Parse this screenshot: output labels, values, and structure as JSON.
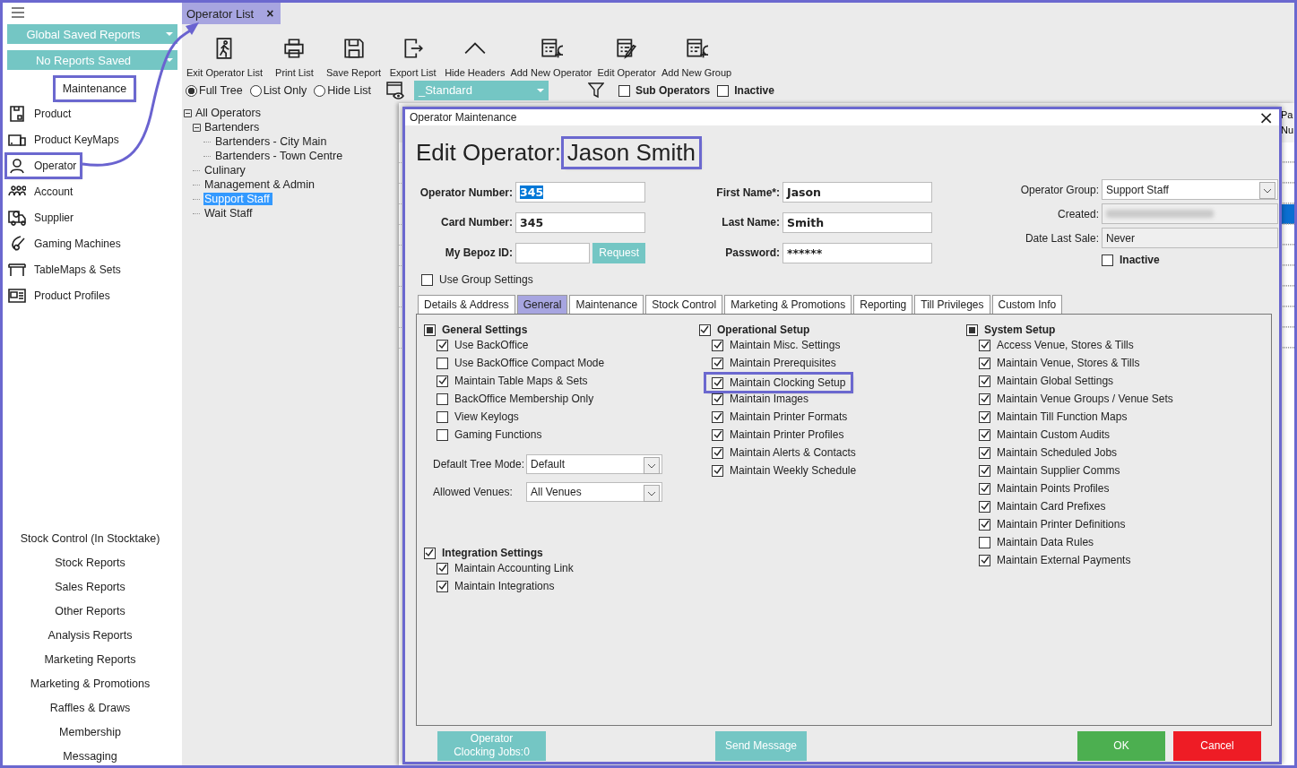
{
  "sidebar": {
    "report_dropdowns": [
      "Global Saved Reports",
      "No Reports Saved"
    ],
    "section": {
      "label": "Maintenance",
      "highlighted": true
    },
    "items": [
      {
        "label": "Product",
        "highlighted": false
      },
      {
        "label": "Product KeyMaps",
        "highlighted": false
      },
      {
        "label": "Operator",
        "highlighted": true
      },
      {
        "label": "Account",
        "highlighted": false
      },
      {
        "label": "Supplier",
        "highlighted": false
      },
      {
        "label": "Gaming Machines",
        "highlighted": false
      },
      {
        "label": "TableMaps & Sets",
        "highlighted": false
      },
      {
        "label": "Product Profiles",
        "highlighted": false
      }
    ],
    "links": [
      "Stock Control (In Stocktake)",
      "Stock Reports",
      "Sales Reports",
      "Other Reports",
      "Analysis Reports",
      "Marketing Reports",
      "Marketing & Promotions",
      "Raffles & Draws",
      "Membership",
      "Messaging"
    ]
  },
  "tab": {
    "label": "Operator List",
    "close": "×"
  },
  "toolbar": [
    "Exit Operator List",
    "Print List",
    "Save Report",
    "Export List",
    "Hide Headers",
    "Add New Operator",
    "Edit Operator",
    "Add New Group"
  ],
  "view_modes": [
    {
      "label": "Full Tree",
      "selected": true
    },
    {
      "label": "List Only",
      "selected": false
    },
    {
      "label": "Hide List",
      "selected": false
    }
  ],
  "layout_dropdown": "_Standard",
  "filters": [
    {
      "label": "Sub Operators",
      "checked": false
    },
    {
      "label": "Inactive",
      "checked": false
    }
  ],
  "tree": [
    {
      "label": "All Operators",
      "expanded": true,
      "selected": false,
      "children": [
        {
          "label": "Bartenders",
          "expanded": true,
          "selected": false,
          "children": [
            {
              "label": "Bartenders - City Main",
              "selected": false
            },
            {
              "label": "Bartenders - Town Centre",
              "selected": false
            }
          ]
        },
        {
          "label": "Culinary",
          "selected": false
        },
        {
          "label": "Management & Admin",
          "selected": false
        },
        {
          "label": "Support Staff",
          "selected": true
        },
        {
          "label": "Wait Staff",
          "selected": false
        }
      ]
    }
  ],
  "grid": {
    "header": [
      "Pa",
      "Nu"
    ],
    "rows": [
      {
        "selected": false
      },
      {
        "selected": false
      },
      {
        "selected": false
      },
      {
        "selected": true
      },
      {
        "selected": false
      },
      {
        "selected": false
      },
      {
        "selected": false
      },
      {
        "selected": false
      },
      {
        "selected": false
      },
      {
        "selected": false
      }
    ]
  },
  "dialog": {
    "title": "Operator Maintenance",
    "close": "×",
    "heading": "Edit Operator:",
    "name": "Jason Smith",
    "name_highlighted": true,
    "operator_number": {
      "label": "Operator Number:",
      "value": "345"
    },
    "card_number": {
      "label": "Card Number:",
      "value": "345"
    },
    "bepoz_id": {
      "label": "My Bepoz ID:",
      "button": "Request"
    },
    "first_name": {
      "label": "First Name*:",
      "value": "Jason"
    },
    "last_name": {
      "label": "Last Name:",
      "value": "Smith"
    },
    "password": {
      "label": "Password:",
      "value": "******"
    },
    "operator_group": {
      "label": "Operator Group:",
      "value": "Support Staff"
    },
    "created": {
      "label": "Created:",
      "redacted": true
    },
    "date_last_sale": {
      "label": "Date Last Sale:",
      "value": "Never"
    },
    "inactive": {
      "label": "Inactive",
      "checked": false
    },
    "use_group_settings": {
      "label": "Use Group Settings",
      "checked": false
    },
    "tabs": [
      {
        "label": "Details & Address",
        "selected": false
      },
      {
        "label": "General",
        "selected": true
      },
      {
        "label": "Maintenance",
        "selected": false
      },
      {
        "label": "Stock Control",
        "selected": false
      },
      {
        "label": "Marketing & Promotions",
        "selected": false
      },
      {
        "label": "Reporting",
        "selected": false
      },
      {
        "label": "Till Privileges",
        "selected": false
      },
      {
        "label": "Custom Info",
        "selected": false
      }
    ],
    "general_settings": {
      "label": "General Settings",
      "checked": false,
      "indeterminate": true,
      "items": [
        {
          "label": "Use BackOffice",
          "checked": true,
          "highlighted": false
        },
        {
          "label": "Use BackOffice Compact Mode",
          "checked": false,
          "highlighted": false
        },
        {
          "label": "Maintain Table Maps & Sets",
          "checked": true,
          "highlighted": false
        },
        {
          "label": "BackOffice Membership Only",
          "checked": false,
          "highlighted": false
        },
        {
          "label": "View Keylogs",
          "checked": false,
          "highlighted": false
        },
        {
          "label": "Gaming Functions",
          "checked": false,
          "highlighted": false
        }
      ]
    },
    "default_tree_mode": {
      "label": "Default Tree Mode:",
      "value": "Default"
    },
    "allowed_venues": {
      "label": "Allowed Venues:",
      "value": "All Venues"
    },
    "integration_settings": {
      "label": "Integration Settings",
      "checked": true,
      "indeterminate": false,
      "items": [
        {
          "label": "Maintain Accounting Link",
          "checked": true,
          "highlighted": false
        },
        {
          "label": "Maintain Integrations",
          "checked": true,
          "highlighted": false
        }
      ]
    },
    "operational_setup": {
      "label": "Operational Setup",
      "checked": true,
      "indeterminate": false,
      "items": [
        {
          "label": "Maintain Misc. Settings",
          "checked": true,
          "highlighted": false
        },
        {
          "label": "Maintain Prerequisites",
          "checked": true,
          "highlighted": false
        },
        {
          "label": "Maintain Clocking Setup",
          "checked": true,
          "highlighted": true
        },
        {
          "label": "Maintain Images",
          "checked": true,
          "highlighted": false
        },
        {
          "label": "Maintain Printer Formats",
          "checked": true,
          "highlighted": false
        },
        {
          "label": "Maintain Printer Profiles",
          "checked": true,
          "highlighted": false
        },
        {
          "label": "Maintain Alerts & Contacts",
          "checked": true,
          "highlighted": false
        },
        {
          "label": "Maintain Weekly Schedule",
          "checked": true,
          "highlighted": false
        }
      ]
    },
    "system_setup": {
      "label": "System Setup",
      "checked": false,
      "indeterminate": true,
      "items": [
        {
          "label": "Access Venue, Stores & Tills",
          "checked": true,
          "highlighted": false
        },
        {
          "label": "Maintain Venue, Stores & Tills",
          "checked": true,
          "highlighted": false
        },
        {
          "label": "Maintain Global Settings",
          "checked": true,
          "highlighted": false
        },
        {
          "label": "Maintain Venue Groups / Venue Sets",
          "checked": true,
          "highlighted": false
        },
        {
          "label": "Maintain Till Function Maps",
          "checked": true,
          "highlighted": false
        },
        {
          "label": "Maintain Custom Audits",
          "checked": true,
          "highlighted": false
        },
        {
          "label": "Maintain Scheduled Jobs",
          "checked": true,
          "highlighted": false
        },
        {
          "label": "Maintain Supplier Comms",
          "checked": true,
          "highlighted": false
        },
        {
          "label": "Maintain Points Profiles",
          "checked": true,
          "highlighted": false
        },
        {
          "label": "Maintain Card Prefixes",
          "checked": true,
          "highlighted": false
        },
        {
          "label": "Maintain Printer Definitions",
          "checked": true,
          "highlighted": false
        },
        {
          "label": "Maintain Data Rules",
          "checked": false,
          "highlighted": false
        },
        {
          "label": "Maintain External Payments",
          "checked": true,
          "highlighted": false
        }
      ]
    },
    "buttons": [
      {
        "label": "Operator\nClocking Jobs:0",
        "kind": "teal"
      },
      {
        "label": "Send Message",
        "kind": "teal"
      },
      {
        "label": "OK",
        "kind": "ok"
      },
      {
        "label": "Cancel",
        "kind": "cancel"
      }
    ]
  }
}
